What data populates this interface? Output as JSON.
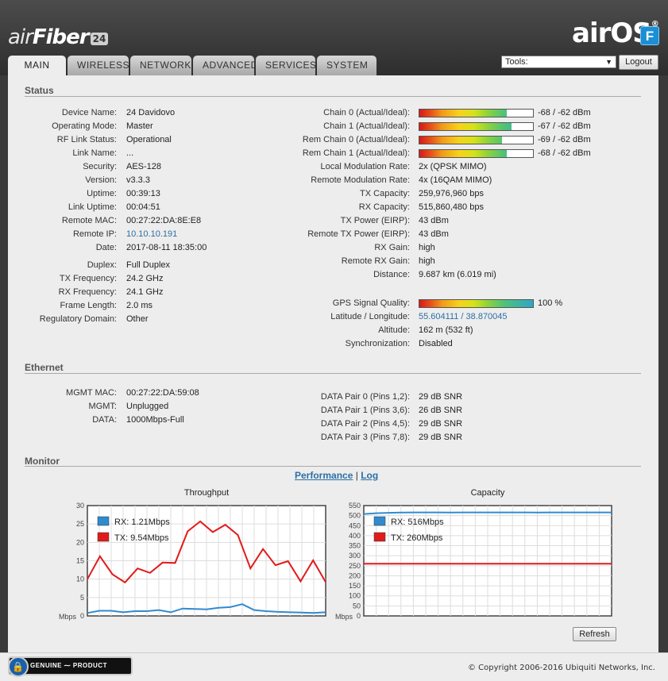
{
  "header": {
    "logo_left_prefix": "air",
    "logo_left_main": "Fiber",
    "logo_left_badge": "24",
    "logo_right": "airOS",
    "logo_right_reg": "®",
    "logo_f": "F"
  },
  "tabs": [
    "MAIN",
    "WIRELESS",
    "NETWORK",
    "ADVANCED",
    "SERVICES",
    "SYSTEM"
  ],
  "tools": {
    "value": "Tools:",
    "arrow": "▼"
  },
  "logout_label": "Logout",
  "status": {
    "title": "Status",
    "left": [
      {
        "label": "Device Name:",
        "value": "24 Davidovo"
      },
      {
        "label": "Operating Mode:",
        "value": "Master"
      },
      {
        "label": "RF Link Status:",
        "value": "Operational"
      },
      {
        "label": "Link Name:",
        "value": "..."
      },
      {
        "label": "Security:",
        "value": "AES-128"
      },
      {
        "label": "Version:",
        "value": "v3.3.3"
      },
      {
        "label": "Uptime:",
        "value": "00:39:13"
      },
      {
        "label": "Link Uptime:",
        "value": "00:04:51"
      },
      {
        "label": "Remote MAC:",
        "value": "00:27:22:DA:8E:E8"
      },
      {
        "label": "Remote IP:",
        "value": "10.10.10.191"
      },
      {
        "label": "Date:",
        "value": "2017-08-11 18:35:00"
      },
      {
        "label": "Duplex:",
        "value": "Full Duplex"
      },
      {
        "label": "TX Frequency:",
        "value": "24.2 GHz"
      },
      {
        "label": "RX Frequency:",
        "value": "24.1 GHz"
      },
      {
        "label": "Frame Length:",
        "value": "2.0 ms"
      },
      {
        "label": "Regulatory Domain:",
        "value": "Other"
      }
    ],
    "chains": [
      {
        "label": "Chain 0 (Actual/Ideal):",
        "value": "-68 / -62 dBm",
        "level": 0.77
      },
      {
        "label": "Chain 1 (Actual/Ideal):",
        "value": "-67 / -62 dBm",
        "level": 0.81
      },
      {
        "label": "Rem Chain 0 (Actual/Ideal):",
        "value": "-69 / -62 dBm",
        "level": 0.73
      },
      {
        "label": "Rem Chain 1 (Actual/Ideal):",
        "value": "-68 / -62 dBm",
        "level": 0.77
      }
    ],
    "right": [
      {
        "label": "Local Modulation Rate:",
        "value": "2x (QPSK MIMO)"
      },
      {
        "label": "Remote Modulation Rate:",
        "value": "4x (16QAM MIMO)"
      },
      {
        "label": "TX Capacity:",
        "value": "259,976,960 bps"
      },
      {
        "label": "RX Capacity:",
        "value": "515,860,480 bps"
      },
      {
        "label": "TX Power (EIRP):",
        "value": "43 dBm"
      },
      {
        "label": "Remote TX Power (EIRP):",
        "value": "43 dBm"
      },
      {
        "label": "RX Gain:",
        "value": "high"
      },
      {
        "label": "Remote RX Gain:",
        "value": "high"
      },
      {
        "label": "Distance:",
        "value": "9.687 km (6.019 mi)"
      }
    ],
    "gps": {
      "label": "GPS Signal Quality:",
      "value": "100 %",
      "level": 1.0
    },
    "right2": [
      {
        "label": "Latitude / Longitude:",
        "value": "55.604111 / 38.870045"
      },
      {
        "label": "Altitude:",
        "value": "162 m (532 ft)"
      },
      {
        "label": "Synchronization:",
        "value": "Disabled"
      }
    ]
  },
  "ethernet": {
    "title": "Ethernet",
    "left": [
      {
        "label": "MGMT MAC:",
        "value": "00:27:22:DA:59:08"
      },
      {
        "label": "MGMT:",
        "value": "Unplugged"
      },
      {
        "label": "DATA:",
        "value": "1000Mbps-Full"
      }
    ],
    "right": [
      {
        "label": "DATA Pair 0 (Pins 1,2):",
        "value": "29 dB SNR"
      },
      {
        "label": "DATA Pair 1 (Pins 3,6):",
        "value": "26 dB SNR"
      },
      {
        "label": "DATA Pair 2 (Pins 4,5):",
        "value": "29 dB SNR"
      },
      {
        "label": "DATA Pair 3 (Pins 7,8):",
        "value": "29 dB SNR"
      }
    ]
  },
  "monitor": {
    "title": "Monitor",
    "link_performance": "Performance",
    "separator": "|",
    "link_log": "Log",
    "refresh_label": "Refresh"
  },
  "chart_data": [
    {
      "type": "line",
      "title": "Throughput",
      "unit_label": "Mbps",
      "ylim": [
        0,
        30
      ],
      "yticks": [
        0,
        5,
        10,
        15,
        20,
        25,
        30
      ],
      "grid": true,
      "legend_position": "top-left",
      "series": [
        {
          "name": "RX: 1.21Mbps",
          "color": "#2f8bd0",
          "values": [
            0.8,
            1.4,
            1.4,
            1.0,
            1.3,
            1.3,
            1.6,
            1.0,
            2.0,
            1.9,
            1.8,
            2.2,
            2.4,
            3.2,
            1.6,
            1.3,
            1.1,
            1.0,
            0.9,
            0.8,
            1.0
          ]
        },
        {
          "name": "TX: 9.54Mbps",
          "color": "#e11b1b",
          "values": [
            10.0,
            16.2,
            11.3,
            9.1,
            12.9,
            11.7,
            14.5,
            14.4,
            23.0,
            25.7,
            22.8,
            24.8,
            22.0,
            12.9,
            18.2,
            13.8,
            14.9,
            9.4,
            15.1,
            9.2
          ]
        }
      ]
    },
    {
      "type": "line",
      "title": "Capacity",
      "unit_label": "Mbps",
      "ylim": [
        0,
        550
      ],
      "yticks": [
        0,
        50,
        100,
        150,
        200,
        250,
        300,
        350,
        400,
        450,
        500,
        550
      ],
      "grid": true,
      "legend_position": "top-left",
      "series": [
        {
          "name": "RX: 516Mbps",
          "color": "#2f8bd0",
          "values": [
            508,
            512,
            514,
            515,
            516,
            516,
            516,
            515,
            516,
            516,
            516,
            516,
            516,
            516,
            515,
            516,
            516,
            516,
            516,
            516,
            516
          ]
        },
        {
          "name": "TX: 260Mbps",
          "color": "#e11b1b",
          "values": [
            260,
            260,
            260,
            260,
            260,
            260,
            260,
            260,
            260,
            260,
            260,
            260,
            260,
            260,
            260,
            260,
            260,
            260,
            260,
            260,
            260
          ]
        }
      ]
    }
  ],
  "footer": {
    "genuine_product": "GENUINE ⁓ PRODUCT",
    "lock_glyph": "🔒",
    "copyright": "© Copyright 2006-2016 Ubiquiti Networks, Inc."
  }
}
